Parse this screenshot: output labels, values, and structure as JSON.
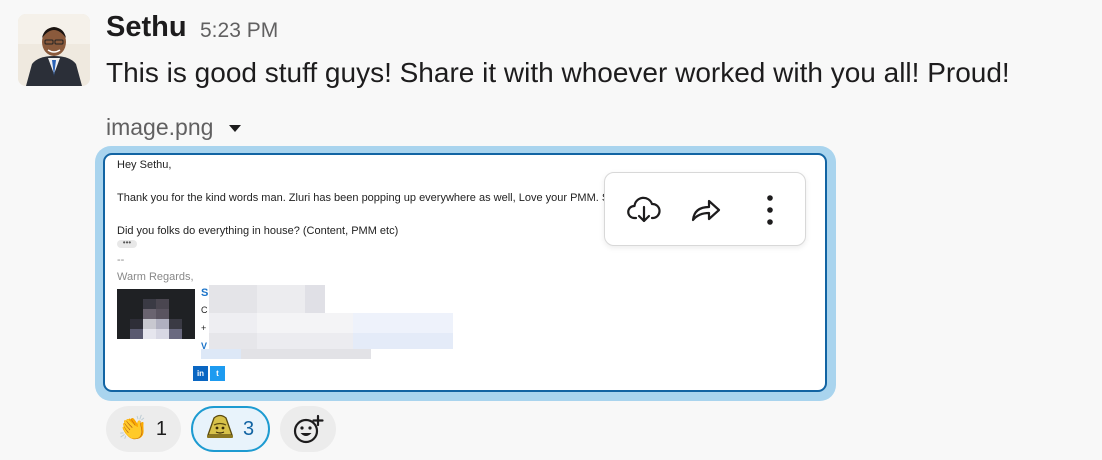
{
  "message": {
    "author": "Sethu",
    "time": "5:23 PM",
    "text": "This is good stuff guys! Share it with whoever worked with you all! Proud!"
  },
  "attachment": {
    "filename": "image.png",
    "email": {
      "greeting": "Hey Sethu,",
      "line1": "Thank you for the kind words man. Zluri has been popping up everywhere as well, Love your PMM. Se",
      "line2": "Did you folks do everything in house? (Content, PMM etc)",
      "dots": "•••",
      "separator": "--",
      "signoff": "Warm Regards,",
      "sig_name_initial": "S",
      "sig_line2_initial": "C",
      "sig_line3_initial": "+",
      "sig_line4_initial": "V",
      "social": [
        "in",
        "t"
      ]
    },
    "toolbar": {
      "icons": [
        "download-icon",
        "share-icon",
        "more-icon"
      ]
    }
  },
  "reactions": [
    {
      "emoji": "👏",
      "count": "1",
      "active": false
    },
    {
      "emoji": "🔔",
      "count": "3",
      "active": true
    }
  ],
  "colors": {
    "accent": "#1264a3",
    "active_border": "#1d9bd1",
    "preview_ring": "#a9d4ee"
  }
}
